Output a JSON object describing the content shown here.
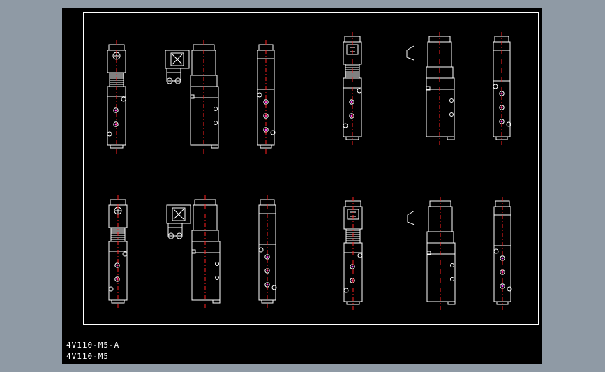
{
  "colors": {
    "background": "#000000",
    "outline": "#ffffff",
    "centerline": "#ff2020",
    "port": "#ff40ff",
    "window_frame": "#8f9aa5"
  },
  "labels": [
    "4V110-M5-A",
    "4V110-M5"
  ],
  "views": [
    {
      "quadrant": "top-left",
      "variant": "terminal-box"
    },
    {
      "quadrant": "top-right",
      "variant": "plug-connector"
    },
    {
      "quadrant": "bottom-left",
      "variant": "terminal-box"
    },
    {
      "quadrant": "bottom-right",
      "variant": "plug-connector"
    }
  ]
}
